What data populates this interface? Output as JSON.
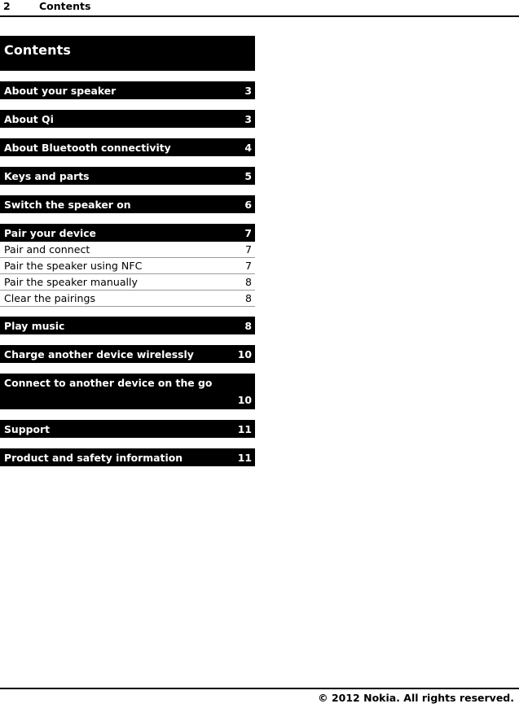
{
  "header": {
    "page_number": "2",
    "section_title": "Contents"
  },
  "toc": {
    "title": "Contents",
    "groups": [
      {
        "entries": [
          {
            "label": "About your speaker",
            "page": "3",
            "level": 1
          }
        ]
      },
      {
        "entries": [
          {
            "label": "About Qi",
            "page": "3",
            "level": 1
          }
        ]
      },
      {
        "entries": [
          {
            "label": "About Bluetooth connectivity",
            "page": "4",
            "level": 1
          }
        ]
      },
      {
        "entries": [
          {
            "label": "Keys and parts",
            "page": "5",
            "level": 1
          }
        ]
      },
      {
        "entries": [
          {
            "label": "Switch the speaker on",
            "page": "6",
            "level": 1
          }
        ]
      },
      {
        "entries": [
          {
            "label": "Pair your device",
            "page": "7",
            "level": 1
          },
          {
            "label": "Pair and connect",
            "page": "7",
            "level": 2
          },
          {
            "label": "Pair the speaker using NFC",
            "page": "7",
            "level": 2
          },
          {
            "label": "Pair the speaker manually",
            "page": "8",
            "level": 2
          },
          {
            "label": "Clear the pairings",
            "page": "8",
            "level": 2
          }
        ]
      },
      {
        "entries": [
          {
            "label": "Play music",
            "page": "8",
            "level": 1
          }
        ]
      },
      {
        "entries": [
          {
            "label": "Charge another device wirelessly",
            "page": "10",
            "level": 1
          }
        ]
      },
      {
        "entries": [
          {
            "label": "Connect to another device on the go",
            "page": "10",
            "level": 1,
            "wraps": true
          }
        ]
      },
      {
        "entries": [
          {
            "label": "Support",
            "page": "11",
            "level": 1
          }
        ]
      },
      {
        "entries": [
          {
            "label": "Product and safety information",
            "page": "11",
            "level": 1
          }
        ]
      }
    ]
  },
  "footer": {
    "copyright": "© 2012 Nokia. All rights reserved."
  },
  "colors": {
    "bar_background": "#000000",
    "bar_text": "#ffffff",
    "page_background": "#ffffff",
    "body_text": "#000000",
    "rule": "#9a9a9a"
  }
}
